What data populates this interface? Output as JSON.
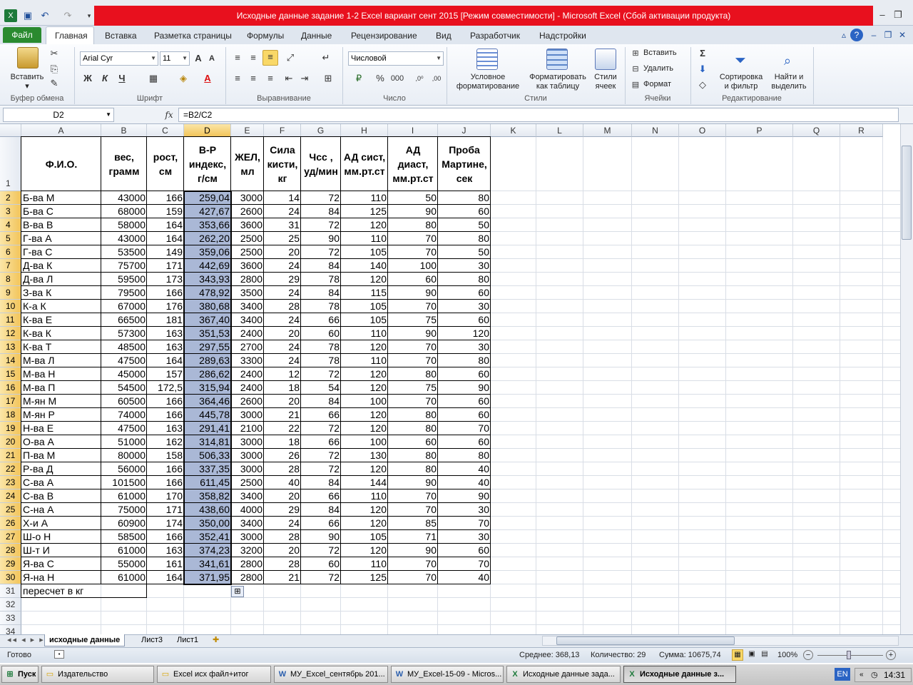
{
  "title": "Исходные данные задание 1-2 Excel вариант сент 2015  [Режим совместимости]  -  Microsoft Excel (Сбой активации продукта)",
  "ribbon": {
    "tabs": [
      "Файл",
      "Главная",
      "Вставка",
      "Разметка страницы",
      "Формулы",
      "Данные",
      "Рецензирование",
      "Вид",
      "Разработчик",
      "Надстройки"
    ],
    "clipboard": {
      "label": "Буфер обмена",
      "paste": "Вставить"
    },
    "font": {
      "label": "Шрифт",
      "name": "Arial Cyr",
      "size": "11"
    },
    "alignment": {
      "label": "Выравнивание"
    },
    "number": {
      "label": "Число",
      "format": "Числовой"
    },
    "styles": {
      "label": "Стили",
      "cond": "Условное\nформатирование",
      "astable": "Форматировать\nкак таблицу",
      "cellstyles": "Стили\nячеек"
    },
    "cells": {
      "label": "Ячейки",
      "insert": "Вставить",
      "delete": "Удалить",
      "format": "Формат"
    },
    "editing": {
      "label": "Редактирование",
      "sort": "Сортировка\nи фильтр",
      "find": "Найти и\nвыделить"
    }
  },
  "formula_bar": {
    "name_box": "D2",
    "fx": "fx",
    "formula": "=B2/C2"
  },
  "columns": [
    "A",
    "B",
    "C",
    "D",
    "E",
    "F",
    "G",
    "H",
    "I",
    "J",
    "K",
    "L",
    "M",
    "N",
    "O",
    "P",
    "Q",
    "R"
  ],
  "rows": [
    "1",
    "2",
    "3",
    "4",
    "5",
    "6",
    "7",
    "8",
    "9",
    "10",
    "11",
    "12",
    "13",
    "14",
    "15",
    "16",
    "17",
    "18",
    "19",
    "20",
    "21",
    "22",
    "23",
    "24",
    "25",
    "26",
    "27",
    "28",
    "29",
    "30",
    "31",
    "32",
    "33",
    "34"
  ],
  "headers": [
    "Ф.И.О.",
    "вес,\nграмм",
    "рост,\nсм",
    "В-Р\nиндекс,\nг/см",
    "ЖЕЛ,\nмл",
    "Сила\nкисти,\nкг",
    "Чсс ,\nуд/мин",
    "АД сист,\nмм.рт.ст",
    "АД\nдиаст,\nмм.рт.ст",
    "Проба\nМартине,\nсек"
  ],
  "data": [
    [
      "Б-ва М",
      "43000",
      "166",
      "259,04",
      "3000",
      "14",
      "72",
      "110",
      "50",
      "80"
    ],
    [
      "Б-ва С",
      "68000",
      "159",
      "427,67",
      "2600",
      "24",
      "84",
      "125",
      "90",
      "60"
    ],
    [
      "В-ва В",
      "58000",
      "164",
      "353,66",
      "3600",
      "31",
      "72",
      "120",
      "80",
      "50"
    ],
    [
      "Г-ва А",
      "43000",
      "164",
      "262,20",
      "2500",
      "25",
      "90",
      "110",
      "70",
      "80"
    ],
    [
      "Г-ва С",
      "53500",
      "149",
      "359,06",
      "2500",
      "20",
      "72",
      "105",
      "70",
      "50"
    ],
    [
      "Д-ва К",
      "75700",
      "171",
      "442,69",
      "3600",
      "24",
      "84",
      "140",
      "100",
      "30"
    ],
    [
      "Д-ва Л",
      "59500",
      "173",
      "343,93",
      "2800",
      "29",
      "78",
      "120",
      "60",
      "80"
    ],
    [
      "З-ва К",
      "79500",
      "166",
      "478,92",
      "3500",
      "24",
      "84",
      "115",
      "90",
      "60"
    ],
    [
      "К-а К",
      "67000",
      "176",
      "380,68",
      "3400",
      "28",
      "78",
      "105",
      "70",
      "30"
    ],
    [
      "К-ва Е",
      "66500",
      "181",
      "367,40",
      "3400",
      "24",
      "66",
      "105",
      "75",
      "60"
    ],
    [
      "К-ва К",
      "57300",
      "163",
      "351,53",
      "2400",
      "20",
      "60",
      "110",
      "90",
      "120"
    ],
    [
      "К-ва Т",
      "48500",
      "163",
      "297,55",
      "2700",
      "24",
      "78",
      "120",
      "70",
      "30"
    ],
    [
      "М-ва Л",
      "47500",
      "164",
      "289,63",
      "3300",
      "24",
      "78",
      "110",
      "70",
      "80"
    ],
    [
      "М-ва Н",
      "45000",
      "157",
      "286,62",
      "2400",
      "12",
      "72",
      "120",
      "80",
      "60"
    ],
    [
      "М-ва П",
      "54500",
      "172,5",
      "315,94",
      "2400",
      "18",
      "54",
      "120",
      "75",
      "90"
    ],
    [
      "М-ян М",
      "60500",
      "166",
      "364,46",
      "2600",
      "20",
      "84",
      "100",
      "70",
      "60"
    ],
    [
      "М-ян Р",
      "74000",
      "166",
      "445,78",
      "3000",
      "21",
      "66",
      "120",
      "80",
      "60"
    ],
    [
      "Н-ва Е",
      "47500",
      "163",
      "291,41",
      "2100",
      "22",
      "72",
      "120",
      "80",
      "70"
    ],
    [
      "О-ва А",
      "51000",
      "162",
      "314,81",
      "3000",
      "18",
      "66",
      "100",
      "60",
      "60"
    ],
    [
      "П-ва М",
      "80000",
      "158",
      "506,33",
      "3000",
      "26",
      "72",
      "130",
      "80",
      "80"
    ],
    [
      "Р-ва Д",
      "56000",
      "166",
      "337,35",
      "3000",
      "28",
      "72",
      "120",
      "80",
      "40"
    ],
    [
      "С-ва А",
      "101500",
      "166",
      "611,45",
      "2500",
      "40",
      "84",
      "144",
      "90",
      "40"
    ],
    [
      "С-ва В",
      "61000",
      "170",
      "358,82",
      "3400",
      "20",
      "66",
      "110",
      "70",
      "90"
    ],
    [
      "С-на А",
      "75000",
      "171",
      "438,60",
      "4000",
      "29",
      "84",
      "120",
      "70",
      "30"
    ],
    [
      "Х-и А",
      "60900",
      "174",
      "350,00",
      "3400",
      "24",
      "66",
      "120",
      "85",
      "70"
    ],
    [
      "Ш-о Н",
      "58500",
      "166",
      "352,41",
      "3000",
      "28",
      "90",
      "105",
      "71",
      "30"
    ],
    [
      "Ш-т И",
      "61000",
      "163",
      "374,23",
      "3200",
      "20",
      "72",
      "120",
      "90",
      "60"
    ],
    [
      "Я-ва С",
      "55000",
      "161",
      "341,61",
      "2800",
      "28",
      "60",
      "110",
      "70",
      "70"
    ],
    [
      "Я-на Н",
      "61000",
      "164",
      "371,95",
      "2800",
      "21",
      "72",
      "125",
      "70",
      "40"
    ]
  ],
  "row31": "пересчет в кг",
  "sheets": [
    "исходные данные",
    "Лист3",
    "Лист1"
  ],
  "status": {
    "ready": "Готово",
    "avg": "Среднее: 368,13",
    "count": "Количество: 29",
    "sum": "Сумма: 10675,74",
    "zoom": "100%"
  },
  "taskbar": {
    "start": "Пуск",
    "items": [
      "Издательство",
      "Excel исх файл+итог",
      "МУ_Excel_сентябрь 201...",
      "МУ_Excel-15-09 - Micros...",
      "Исходные данные зада...",
      "Исходные данные з..."
    ],
    "lang": "EN",
    "time": "14:31"
  }
}
